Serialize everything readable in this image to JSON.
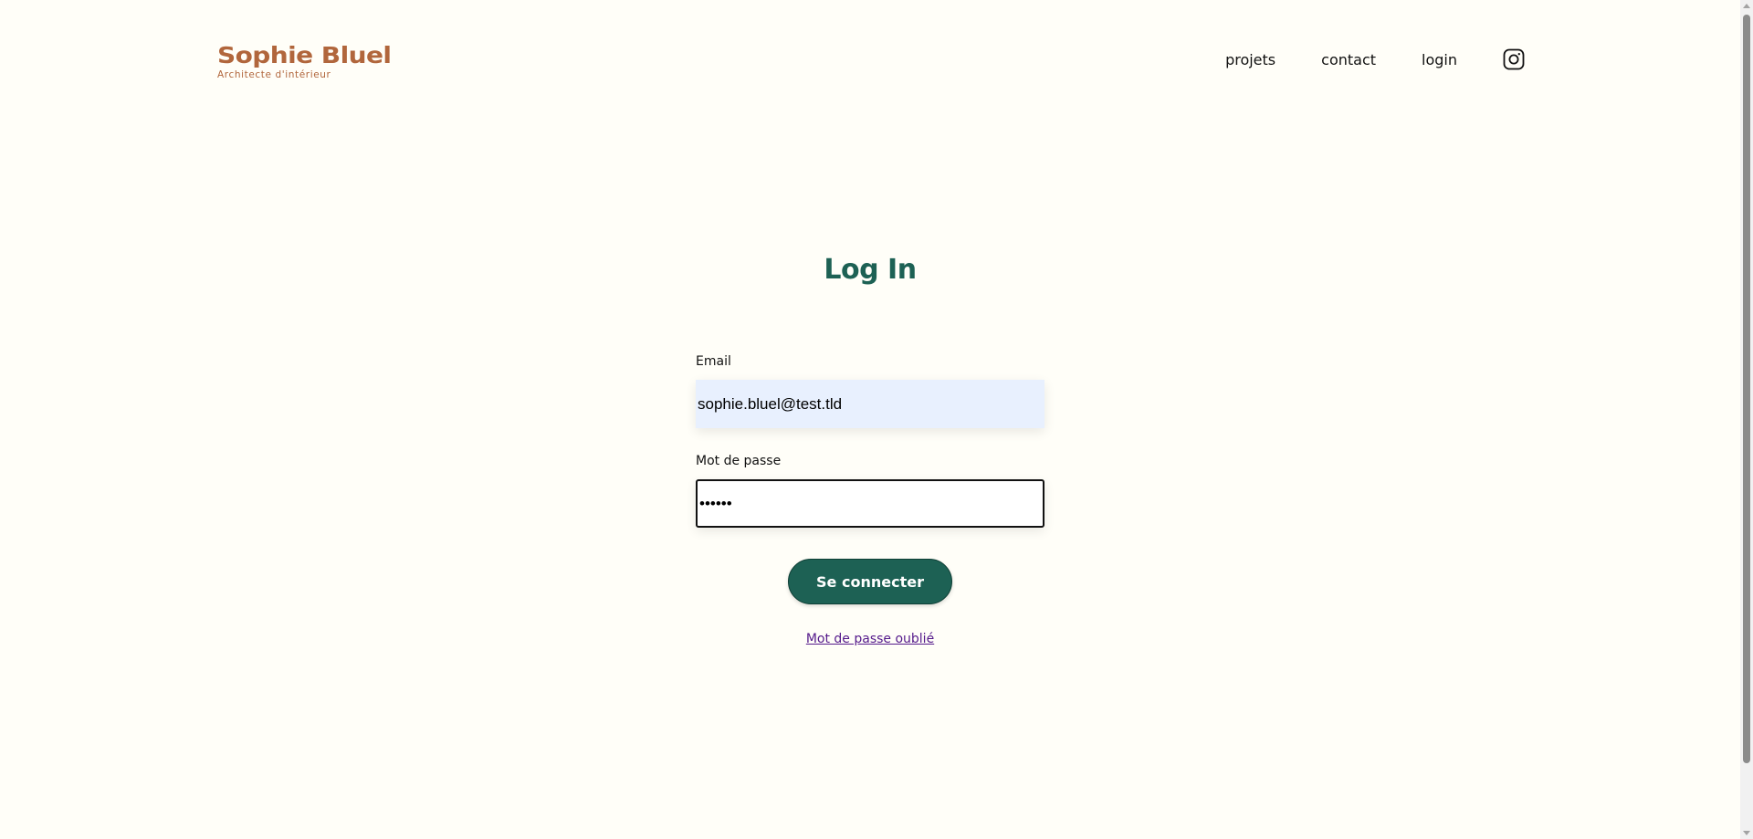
{
  "header": {
    "logo_name": "Sophie Bluel",
    "logo_subtitle": "Architecte d'intérieur",
    "nav": {
      "projects": "projets",
      "contact": "contact",
      "login": "login",
      "instagram_icon": "instagram-icon"
    }
  },
  "main": {
    "title": "Log In",
    "email": {
      "label": "Email",
      "value": "sophie.bluel@test.tld"
    },
    "password": {
      "label": "Mot de passe",
      "value": "••••••"
    },
    "submit_label": "Se connecter",
    "forgot_label": "Mot de passe oublié"
  },
  "colors": {
    "background": "#FFFEF8",
    "brand": "#B1663C",
    "accent": "#1D6154",
    "autofill": "#E8F0FE",
    "visited_link": "#551A8B"
  }
}
